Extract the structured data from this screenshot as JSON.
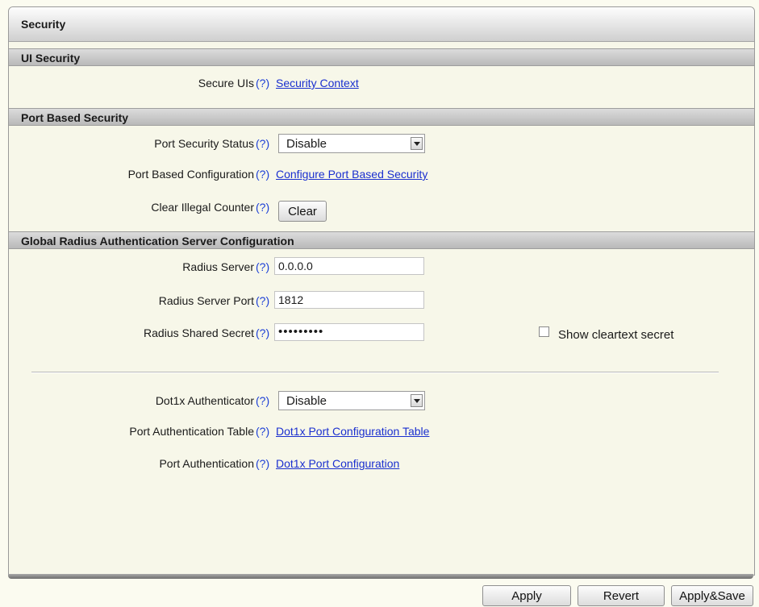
{
  "panel": {
    "title": "Security"
  },
  "ui_security": {
    "header": "UI Security",
    "secure_uis": {
      "label": "Secure UIs",
      "help": "(?)",
      "link": "Security Context"
    }
  },
  "port_security": {
    "header": "Port Based Security",
    "status": {
      "label": "Port Security Status",
      "help": "(?)",
      "value": "Disable"
    },
    "config": {
      "label": "Port Based Configuration",
      "help": "(?)",
      "link": "Configure Port Based Security"
    },
    "clear": {
      "label": "Clear Illegal Counter",
      "help": "(?)",
      "button": "Clear"
    }
  },
  "radius": {
    "header": "Global Radius Authentication Server Configuration",
    "server": {
      "label": "Radius Server",
      "help": "(?)",
      "value": "0.0.0.0"
    },
    "port": {
      "label": "Radius Server Port",
      "help": "(?)",
      "value": "1812"
    },
    "secret": {
      "label": "Radius Shared Secret",
      "help": "(?)",
      "value": "•••••••••",
      "show_label": "Show cleartext secret",
      "show_checked": false
    },
    "dot1x": {
      "label": "Dot1x Authenticator",
      "help": "(?)",
      "value": "Disable"
    },
    "auth_table": {
      "label": "Port Authentication Table",
      "help": "(?)",
      "link": "Dot1x Port Configuration Table"
    },
    "auth": {
      "label": "Port Authentication",
      "help": "(?)",
      "link": "Dot1x Port Configuration"
    }
  },
  "footer": {
    "apply": "Apply",
    "revert": "Revert",
    "apply_save": "Apply&Save"
  }
}
